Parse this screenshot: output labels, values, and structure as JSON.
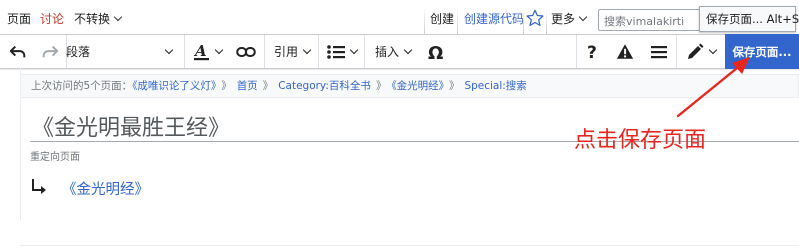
{
  "tabs": {
    "view": "页面",
    "talk": "讨论",
    "variant": "不转换",
    "create": "创建",
    "create_source": "创建源代码",
    "more": "更多"
  },
  "search": {
    "placeholder": "搜索vimalakirti"
  },
  "tooltip": "保存页面... Alt+S",
  "toolbar": {
    "paragraph_label": "段落",
    "cite_label": "引用",
    "insert_label": "插入",
    "save_label": "保存页面..."
  },
  "breadcrumb": {
    "prefix": "上次访问的5个页面：",
    "sep": "》",
    "items": [
      "《成唯识论了义灯》",
      "首页",
      "Category:百科全书",
      "《金光明经》",
      "Special:搜索"
    ]
  },
  "page": {
    "title": "《金光明最胜王经》",
    "redirect_label": "重定向页面",
    "redirect_target": "《金光明经》"
  },
  "annotation": {
    "text": "点击保存页面"
  },
  "colors": {
    "accent": "#3366cc",
    "annotation": "#e8251f",
    "talk_tab": "#c0392b"
  }
}
